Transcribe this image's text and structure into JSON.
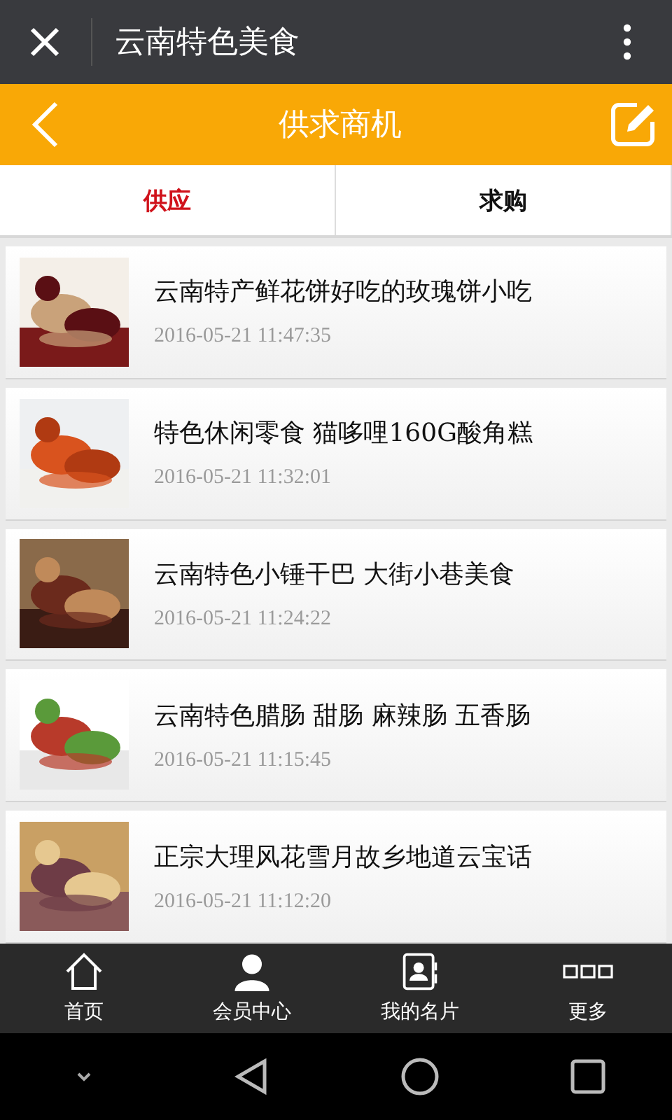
{
  "top_bar": {
    "title": "云南特色美食"
  },
  "header": {
    "title": "供求商机"
  },
  "tabs": [
    {
      "label": "供应",
      "selected": true
    },
    {
      "label": "求购",
      "selected": false
    }
  ],
  "items": [
    {
      "title": "云南特产鲜花饼好吃的玫瑰饼小吃",
      "date": "2016-05-21 11:47:35"
    },
    {
      "title": "特色休闲零食 猫哆哩160G酸角糕",
      "date": "2016-05-21 11:32:01"
    },
    {
      "title": "云南特色小锤干巴 大街小巷美食",
      "date": "2016-05-21 11:24:22"
    },
    {
      "title": "云南特色腊肠 甜肠 麻辣肠 五香肠",
      "date": "2016-05-21 11:15:45"
    },
    {
      "title": "正宗大理风花雪月故乡地道云宝话",
      "date": "2016-05-21 11:12:20"
    }
  ],
  "bottom_nav": [
    {
      "label": "首页"
    },
    {
      "label": "会员中心"
    },
    {
      "label": "我的名片"
    },
    {
      "label": "更多"
    }
  ]
}
